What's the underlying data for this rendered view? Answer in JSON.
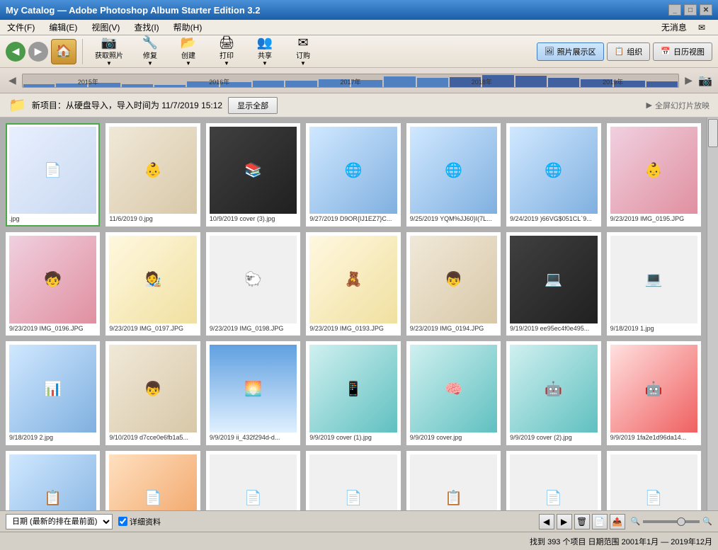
{
  "titleBar": {
    "title": "My Catalog — Adobe Photoshop Album Starter Edition 3.2",
    "controls": [
      "_",
      "□",
      "✕"
    ]
  },
  "menuBar": {
    "items": [
      "文件(F)",
      "编辑(E)",
      "视图(V)",
      "查找(I)",
      "帮助(H)"
    ],
    "notification": "无消息"
  },
  "toolbar": {
    "backLabel": "◀",
    "fwdLabel": "▶",
    "homeIcon": "🏠",
    "buttons": [
      {
        "label": "获取照片",
        "icon": "📷"
      },
      {
        "label": "修复",
        "icon": "🔧"
      },
      {
        "label": "创建",
        "icon": "📂"
      },
      {
        "label": "打印",
        "icon": "🖨"
      },
      {
        "label": "共享",
        "icon": "👥"
      },
      {
        "label": "订购",
        "icon": "✉"
      }
    ],
    "viewButtons": [
      {
        "label": "照片展示区",
        "icon": "🖼",
        "active": true
      },
      {
        "label": "组织",
        "icon": "📋",
        "active": false
      },
      {
        "label": "日历视图",
        "icon": "📅",
        "active": false
      }
    ]
  },
  "timeline": {
    "years": [
      "2015年",
      "2016年",
      "2017年",
      "2018年",
      "2019年"
    ],
    "bars": [
      10,
      15,
      20,
      25,
      35,
      50,
      40,
      30,
      60,
      55,
      45,
      70
    ]
  },
  "importBar": {
    "text": "新项目：从硬盘导入，导入时间为 11/7/2019 15:12",
    "showAllBtn": "显示全部",
    "slideshowLink": "全屏幻灯片放映"
  },
  "photos": [
    {
      "date": "",
      "name": ".jpg",
      "thumbClass": "thumb-doc",
      "icon": "📄",
      "selected": true
    },
    {
      "date": "11/6/2019",
      "name": "0.jpg",
      "thumbClass": "thumb-photo",
      "icon": "👶"
    },
    {
      "date": "10/9/2019",
      "name": "cover (3).jpg",
      "thumbClass": "thumb-dark",
      "icon": "📚"
    },
    {
      "date": "9/27/2019",
      "name": "D9OR{IJ1EZ7}C...",
      "thumbClass": "thumb-blue",
      "icon": "🌐"
    },
    {
      "date": "9/25/2019",
      "name": "YQM%JJ60}I(7L...",
      "thumbClass": "thumb-blue",
      "icon": "🌐"
    },
    {
      "date": "9/24/2019",
      "name": ")66VG$051CL`9...",
      "thumbClass": "thumb-blue",
      "icon": "🌐"
    },
    {
      "date": "9/23/2019",
      "name": "IMG_0195.JPG",
      "thumbClass": "thumb-pink",
      "icon": "👶"
    },
    {
      "date": "9/23/2019",
      "name": "IMG_0196.JPG",
      "thumbClass": "thumb-pink",
      "icon": "🧒"
    },
    {
      "date": "9/23/2019",
      "name": "IMG_0197.JPG",
      "thumbClass": "thumb-cartoon",
      "icon": "🧑‍🎨"
    },
    {
      "date": "9/23/2019",
      "name": "IMG_0198.JPG",
      "thumbClass": "thumb-white",
      "icon": "🐑"
    },
    {
      "date": "9/23/2019",
      "name": "IMG_0193.JPG",
      "thumbClass": "thumb-cartoon",
      "icon": "🧸"
    },
    {
      "date": "9/23/2019",
      "name": "IMG_0194.JPG",
      "thumbClass": "thumb-photo",
      "icon": "👦"
    },
    {
      "date": "9/19/2019",
      "name": "ee95ec4f0e495...",
      "thumbClass": "thumb-dark",
      "icon": "💻"
    },
    {
      "date": "9/18/2019",
      "name": "1.jpg",
      "thumbClass": "thumb-white",
      "icon": "💻"
    },
    {
      "date": "9/18/2019",
      "name": "2.jpg",
      "thumbClass": "thumb-blue",
      "icon": "📊"
    },
    {
      "date": "9/10/2019",
      "name": "d7cce0e6fb1a5...",
      "thumbClass": "thumb-photo",
      "icon": "👦"
    },
    {
      "date": "9/9/2019",
      "name": "ii_432f294d-d...",
      "thumbClass": "thumb-sky",
      "icon": "🌅"
    },
    {
      "date": "9/9/2019",
      "name": "cover (1).jpg",
      "thumbClass": "thumb-teal",
      "icon": "📱"
    },
    {
      "date": "9/9/2019",
      "name": "cover.jpg",
      "thumbClass": "thumb-teal",
      "icon": "🧠"
    },
    {
      "date": "9/9/2019",
      "name": "cover (2).jpg",
      "thumbClass": "thumb-teal",
      "icon": "🤖"
    },
    {
      "date": "9/9/2019",
      "name": "1fa2e1d96da14...",
      "thumbClass": "thumb-red",
      "icon": "🤖"
    },
    {
      "date": "",
      "name": "",
      "thumbClass": "thumb-blue",
      "icon": "📋"
    },
    {
      "date": "",
      "name": "",
      "thumbClass": "thumb-orange",
      "icon": "📄"
    },
    {
      "date": "",
      "name": "",
      "thumbClass": "thumb-white",
      "icon": "📄"
    },
    {
      "date": "",
      "name": "",
      "thumbClass": "thumb-white",
      "icon": "📄"
    },
    {
      "date": "",
      "name": "",
      "thumbClass": "thumb-white",
      "icon": "📋"
    },
    {
      "date": "",
      "name": "",
      "thumbClass": "thumb-white",
      "icon": "📄"
    },
    {
      "date": "",
      "name": "",
      "thumbClass": "thumb-white",
      "icon": "📄"
    }
  ],
  "bottomBar": {
    "sortLabel": "日期 (最新的排在最前面)",
    "detailLabel": "详细资料",
    "icons": [
      "⬅",
      "➡",
      "🗑",
      "📄",
      "📤"
    ],
    "zoomMin": "🔍-",
    "zoomMax": "🔍+"
  },
  "statusBar": {
    "text": "找到 393 个项目 日期范围 2001年1月 — 2019年12月"
  }
}
